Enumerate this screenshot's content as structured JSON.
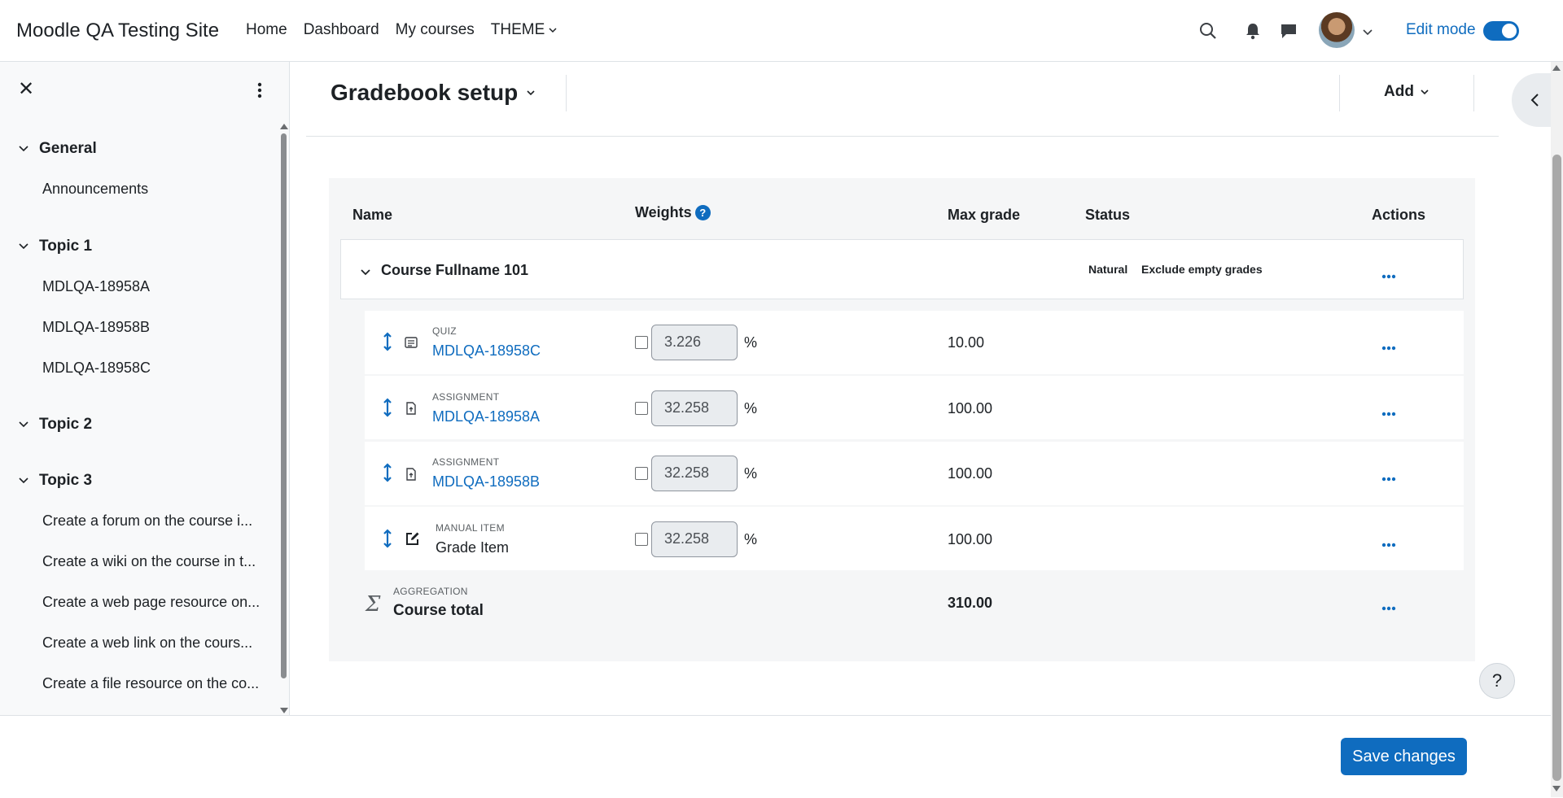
{
  "site": {
    "name": "Moodle QA Testing Site"
  },
  "nav": {
    "links": [
      "Home",
      "Dashboard",
      "My courses",
      "THEME"
    ],
    "edit_mode_label": "Edit mode",
    "edit_mode_on": true,
    "icons": [
      "search-icon",
      "bell-icon",
      "chat-icon",
      "user-avatar",
      "chevron-down-icon"
    ]
  },
  "drawer": {
    "sections": [
      {
        "title": "General",
        "items": [
          "Announcements"
        ]
      },
      {
        "title": "Topic 1",
        "items": [
          "MDLQA-18958A",
          "MDLQA-18958B",
          "MDLQA-18958C"
        ]
      },
      {
        "title": "Topic 2",
        "items": []
      },
      {
        "title": "Topic 3",
        "items": [
          "Create a forum on the course i...",
          "Create a wiki on the course in t...",
          "Create a web page resource on...",
          "Create a web link on the cours...",
          "Create a file resource on the co..."
        ]
      }
    ]
  },
  "page": {
    "title": "Gradebook setup",
    "add_label": "Add"
  },
  "table": {
    "headers": {
      "name": "Name",
      "weights": "Weights",
      "weights_help": "?",
      "max_grade": "Max grade",
      "status": "Status",
      "actions": "Actions"
    },
    "course": {
      "name": "Course Fullname 101",
      "status_badges": [
        "Natural",
        "Exclude empty grades"
      ]
    },
    "items": [
      {
        "type": "QUIZ",
        "name": "MDLQA-18958C",
        "is_link": true,
        "weight": "3.226",
        "pct": "%",
        "max": "10.00",
        "icon": "quiz-icon"
      },
      {
        "type": "ASSIGNMENT",
        "name": "MDLQA-18958A",
        "is_link": true,
        "weight": "32.258",
        "pct": "%",
        "max": "100.00",
        "icon": "assignment-icon"
      },
      {
        "type": "ASSIGNMENT",
        "name": "MDLQA-18958B",
        "is_link": true,
        "weight": "32.258",
        "pct": "%",
        "max": "100.00",
        "icon": "assignment-icon"
      },
      {
        "type": "MANUAL ITEM",
        "name": "Grade Item",
        "is_link": false,
        "weight": "32.258",
        "pct": "%",
        "max": "100.00",
        "icon": "edit-icon"
      }
    ],
    "total": {
      "type": "AGGREGATION",
      "name": "Course total",
      "max": "310.00",
      "symbol": "Σ"
    }
  },
  "footer": {
    "save_label": "Save changes"
  },
  "help_fab": "?",
  "colors": {
    "primary": "#0f6cbf",
    "panel_bg": "#f5f6f7",
    "drawer_bg": "#f8f9fa"
  }
}
